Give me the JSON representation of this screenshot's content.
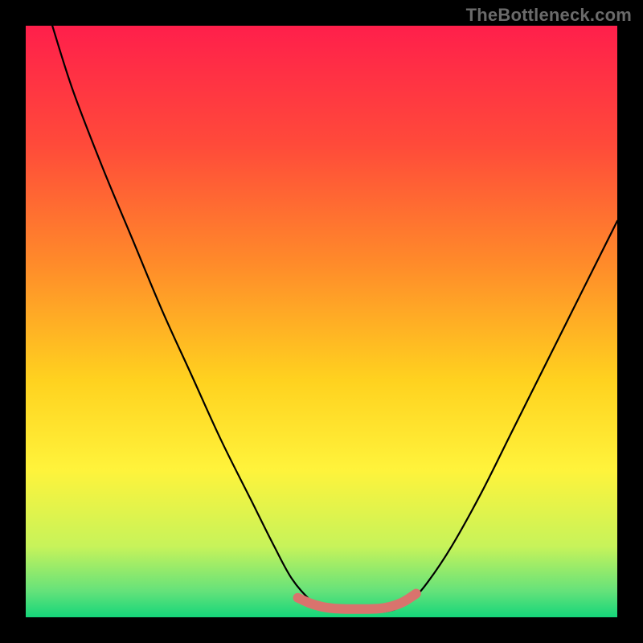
{
  "watermark": "TheBottleneck.com",
  "chart_data": {
    "type": "line",
    "title": "",
    "xlabel": "",
    "ylabel": "",
    "xlim": [
      0,
      100
    ],
    "ylim": [
      0,
      100
    ],
    "gradient_stops": [
      {
        "offset": 0.0,
        "color": "#ff1f4b"
      },
      {
        "offset": 0.2,
        "color": "#ff4a3a"
      },
      {
        "offset": 0.4,
        "color": "#ff8a2a"
      },
      {
        "offset": 0.6,
        "color": "#ffd21f"
      },
      {
        "offset": 0.75,
        "color": "#fff33b"
      },
      {
        "offset": 0.88,
        "color": "#c7f35a"
      },
      {
        "offset": 0.955,
        "color": "#66e27a"
      },
      {
        "offset": 1.0,
        "color": "#15d67a"
      }
    ],
    "series": [
      {
        "name": "bottleneck-curve",
        "color": "#000000",
        "points": [
          {
            "x": 4.5,
            "y": 100.0
          },
          {
            "x": 8.0,
            "y": 89.0
          },
          {
            "x": 13.0,
            "y": 76.0
          },
          {
            "x": 18.0,
            "y": 64.0
          },
          {
            "x": 23.0,
            "y": 52.0
          },
          {
            "x": 28.0,
            "y": 41.0
          },
          {
            "x": 33.0,
            "y": 30.0
          },
          {
            "x": 38.0,
            "y": 20.0
          },
          {
            "x": 42.0,
            "y": 12.0
          },
          {
            "x": 45.0,
            "y": 6.5
          },
          {
            "x": 48.0,
            "y": 3.0
          },
          {
            "x": 50.0,
            "y": 1.6
          },
          {
            "x": 52.0,
            "y": 1.0
          },
          {
            "x": 55.0,
            "y": 0.8
          },
          {
            "x": 58.0,
            "y": 0.8
          },
          {
            "x": 61.0,
            "y": 1.0
          },
          {
            "x": 63.0,
            "y": 1.6
          },
          {
            "x": 65.5,
            "y": 3.2
          },
          {
            "x": 68.0,
            "y": 6.0
          },
          {
            "x": 72.0,
            "y": 12.0
          },
          {
            "x": 77.0,
            "y": 21.0
          },
          {
            "x": 82.0,
            "y": 31.0
          },
          {
            "x": 87.0,
            "y": 41.0
          },
          {
            "x": 92.0,
            "y": 51.0
          },
          {
            "x": 96.0,
            "y": 59.0
          },
          {
            "x": 100.0,
            "y": 67.0
          }
        ]
      },
      {
        "name": "flat-marker",
        "color": "#d9736d",
        "stroke_width": 12,
        "points": [
          {
            "x": 46.0,
            "y": 3.3
          },
          {
            "x": 48.0,
            "y": 2.4
          },
          {
            "x": 50.0,
            "y": 1.8
          },
          {
            "x": 52.0,
            "y": 1.5
          },
          {
            "x": 54.0,
            "y": 1.4
          },
          {
            "x": 56.0,
            "y": 1.4
          },
          {
            "x": 58.0,
            "y": 1.4
          },
          {
            "x": 60.0,
            "y": 1.5
          },
          {
            "x": 62.0,
            "y": 1.9
          },
          {
            "x": 64.0,
            "y": 2.7
          },
          {
            "x": 66.0,
            "y": 4.0
          }
        ]
      }
    ]
  }
}
